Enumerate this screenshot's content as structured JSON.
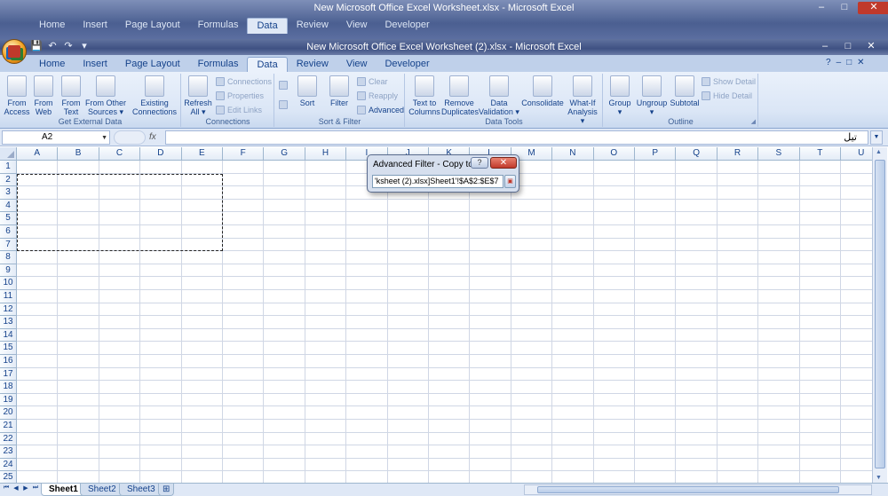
{
  "background_window": {
    "title": "New Microsoft Office Excel Worksheet.xlsx - Microsoft Excel",
    "tabs": [
      "Home",
      "Insert",
      "Page Layout",
      "Formulas",
      "Data",
      "Review",
      "View",
      "Developer"
    ],
    "active_tab": "Data"
  },
  "window": {
    "title": "New Microsoft Office Excel Worksheet (2).xlsx - Microsoft Excel",
    "controls": {
      "minimize": "–",
      "maximize": "□",
      "close": "✕"
    }
  },
  "qat": {
    "save": "💾",
    "undo": "↶",
    "redo": "↷",
    "customize": "▾"
  },
  "tabs": [
    "Home",
    "Insert",
    "Page Layout",
    "Formulas",
    "Data",
    "Review",
    "View",
    "Developer"
  ],
  "active_tab": "Data",
  "ribbon": {
    "get_external_data": {
      "label": "Get External Data",
      "buttons": [
        "From Access",
        "From Web",
        "From Text",
        "From Other Sources ▾",
        "Existing Connections"
      ]
    },
    "connections": {
      "label": "Connections",
      "refresh": "Refresh All ▾",
      "items": [
        "Connections",
        "Properties",
        "Edit Links"
      ]
    },
    "sort_filter": {
      "label": "Sort & Filter",
      "sort": "Sort",
      "filter": "Filter",
      "items": [
        "Clear",
        "Reapply",
        "Advanced"
      ]
    },
    "data_tools": {
      "label": "Data Tools",
      "buttons": [
        "Text to Columns",
        "Remove Duplicates",
        "Data Validation ▾",
        "Consolidate",
        "What-If Analysis ▾"
      ]
    },
    "outline": {
      "label": "Outline",
      "buttons": [
        "Group ▾",
        "Ungroup ▾",
        "Subtotal"
      ],
      "items": [
        "Show Detail",
        "Hide Detail"
      ]
    }
  },
  "formula_bar": {
    "name_box": "A2",
    "fx": "fx",
    "content": "تيل"
  },
  "grid": {
    "columns": [
      "A",
      "B",
      "C",
      "D",
      "E",
      "F",
      "G",
      "H",
      "I",
      "J",
      "K",
      "L",
      "M",
      "N",
      "O",
      "P",
      "Q",
      "R",
      "S",
      "T",
      "U"
    ],
    "rows": [
      "1",
      "2",
      "3",
      "4",
      "5",
      "6",
      "7",
      "8",
      "9",
      "10",
      "11",
      "12",
      "13",
      "14",
      "15",
      "16",
      "17",
      "18",
      "19",
      "20",
      "21",
      "22",
      "23",
      "24",
      "25"
    ],
    "marquee_range": "A2:E7"
  },
  "dialog": {
    "title": "Advanced Filter - Copy to:",
    "help": "?",
    "close": "✕",
    "input_value": "'ksheet (2).xlsx]Sheet1'!$A$2:$E$7"
  },
  "sheets": [
    "Sheet1",
    "Sheet2",
    "Sheet3"
  ],
  "active_sheet": "Sheet1"
}
